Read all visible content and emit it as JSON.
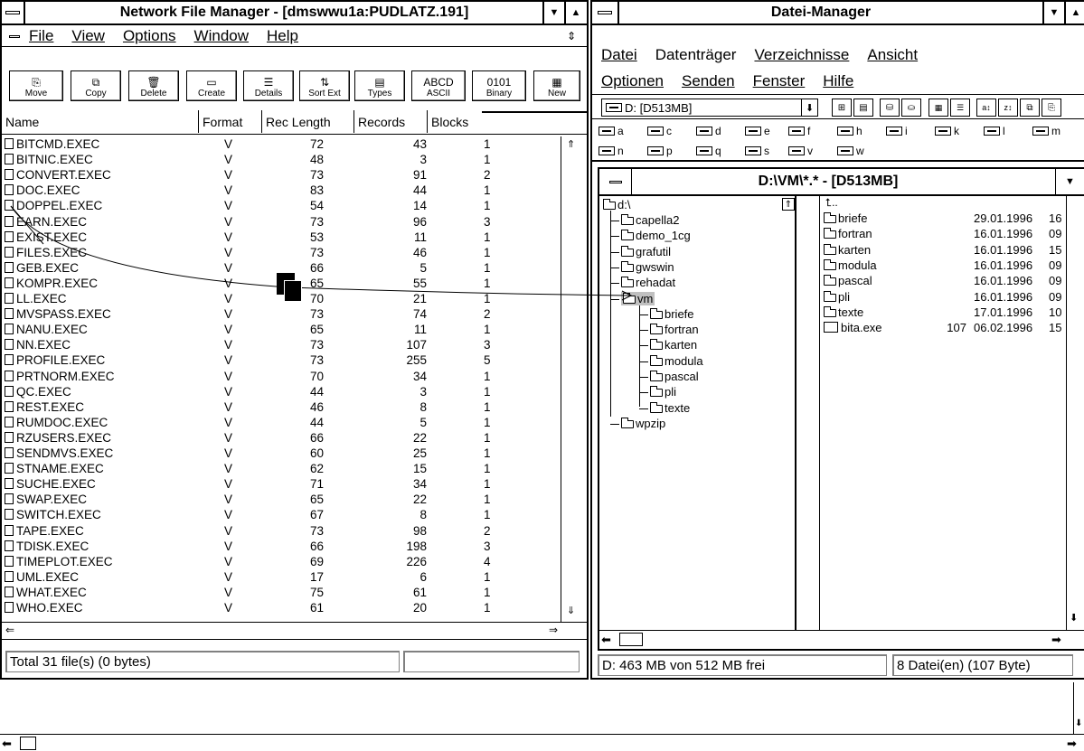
{
  "left": {
    "title": "Network File Manager - [dmswwu1a:PUDLATZ.191]",
    "menu": [
      "File",
      "View",
      "Options",
      "Window",
      "Help"
    ],
    "toolbar": [
      {
        "label": "Move",
        "icon": "move-icon",
        "glyph": "⎘"
      },
      {
        "label": "Copy",
        "icon": "copy-icon",
        "glyph": "⧉"
      },
      {
        "label": "Delete",
        "icon": "delete-icon",
        "glyph": "🗑"
      },
      {
        "label": "Create",
        "icon": "create-icon",
        "glyph": "▭"
      },
      {
        "label": "Details",
        "icon": "details-icon",
        "glyph": "☰"
      },
      {
        "label": "Sort Ext",
        "icon": "sort-ext-icon",
        "glyph": "⇅"
      },
      {
        "label": "Types",
        "icon": "types-icon",
        "glyph": "▤"
      },
      {
        "label": "ASCII",
        "icon": "ascii-icon",
        "glyph": "ABCD"
      },
      {
        "label": "Binary",
        "icon": "binary-icon",
        "glyph": "0101"
      },
      {
        "label": "New",
        "icon": "new-window-icon",
        "glyph": "▦"
      }
    ],
    "columns": [
      "Name",
      "Format",
      "Rec Length",
      "Records",
      "Blocks"
    ],
    "files": [
      {
        "name": "BITCMD.EXEC",
        "format": "V",
        "reclen": "72",
        "records": "43",
        "blocks": "1"
      },
      {
        "name": "BITNIC.EXEC",
        "format": "V",
        "reclen": "48",
        "records": "3",
        "blocks": "1"
      },
      {
        "name": "CONVERT.EXEC",
        "format": "V",
        "reclen": "73",
        "records": "91",
        "blocks": "2"
      },
      {
        "name": "DOC.EXEC",
        "format": "V",
        "reclen": "83",
        "records": "44",
        "blocks": "1"
      },
      {
        "name": "DOPPEL.EXEC",
        "format": "V",
        "reclen": "54",
        "records": "14",
        "blocks": "1"
      },
      {
        "name": "EARN.EXEC",
        "format": "V",
        "reclen": "73",
        "records": "96",
        "blocks": "3"
      },
      {
        "name": "EXIST.EXEC",
        "format": "V",
        "reclen": "53",
        "records": "11",
        "blocks": "1"
      },
      {
        "name": "FILES.EXEC",
        "format": "V",
        "reclen": "73",
        "records": "46",
        "blocks": "1"
      },
      {
        "name": "GEB.EXEC",
        "format": "V",
        "reclen": "66",
        "records": "5",
        "blocks": "1"
      },
      {
        "name": "KOMPR.EXEC",
        "format": "V",
        "reclen": "65",
        "records": "55",
        "blocks": "1"
      },
      {
        "name": "LL.EXEC",
        "format": "V",
        "reclen": "70",
        "records": "21",
        "blocks": "1"
      },
      {
        "name": "MVSPASS.EXEC",
        "format": "V",
        "reclen": "73",
        "records": "74",
        "blocks": "2"
      },
      {
        "name": "NANU.EXEC",
        "format": "V",
        "reclen": "65",
        "records": "11",
        "blocks": "1"
      },
      {
        "name": "NN.EXEC",
        "format": "V",
        "reclen": "73",
        "records": "107",
        "blocks": "3"
      },
      {
        "name": "PROFILE.EXEC",
        "format": "V",
        "reclen": "73",
        "records": "255",
        "blocks": "5"
      },
      {
        "name": "PRTNORM.EXEC",
        "format": "V",
        "reclen": "70",
        "records": "34",
        "blocks": "1"
      },
      {
        "name": "QC.EXEC",
        "format": "V",
        "reclen": "44",
        "records": "3",
        "blocks": "1"
      },
      {
        "name": "REST.EXEC",
        "format": "V",
        "reclen": "46",
        "records": "8",
        "blocks": "1"
      },
      {
        "name": "RUMDOC.EXEC",
        "format": "V",
        "reclen": "44",
        "records": "5",
        "blocks": "1"
      },
      {
        "name": "RZUSERS.EXEC",
        "format": "V",
        "reclen": "66",
        "records": "22",
        "blocks": "1"
      },
      {
        "name": "SENDMVS.EXEC",
        "format": "V",
        "reclen": "60",
        "records": "25",
        "blocks": "1"
      },
      {
        "name": "STNAME.EXEC",
        "format": "V",
        "reclen": "62",
        "records": "15",
        "blocks": "1"
      },
      {
        "name": "SUCHE.EXEC",
        "format": "V",
        "reclen": "71",
        "records": "34",
        "blocks": "1"
      },
      {
        "name": "SWAP.EXEC",
        "format": "V",
        "reclen": "65",
        "records": "22",
        "blocks": "1"
      },
      {
        "name": "SWITCH.EXEC",
        "format": "V",
        "reclen": "67",
        "records": "8",
        "blocks": "1"
      },
      {
        "name": "TAPE.EXEC",
        "format": "V",
        "reclen": "73",
        "records": "98",
        "blocks": "2"
      },
      {
        "name": "TDISK.EXEC",
        "format": "V",
        "reclen": "66",
        "records": "198",
        "blocks": "3"
      },
      {
        "name": "TIMEPLOT.EXEC",
        "format": "V",
        "reclen": "69",
        "records": "226",
        "blocks": "4"
      },
      {
        "name": "UML.EXEC",
        "format": "V",
        "reclen": "17",
        "records": "6",
        "blocks": "1"
      },
      {
        "name": "WHAT.EXEC",
        "format": "V",
        "reclen": "75",
        "records": "61",
        "blocks": "1"
      },
      {
        "name": "WHO.EXEC",
        "format": "V",
        "reclen": "61",
        "records": "20",
        "blocks": "1"
      }
    ],
    "status": "Total 31 file(s) (0 bytes)"
  },
  "right": {
    "title": "Datei-Manager",
    "menu1": [
      "Datei",
      "Datenträger",
      "Verzeichnisse",
      "Ansicht"
    ],
    "menu2": [
      "Optionen",
      "Senden",
      "Fenster",
      "Hilfe"
    ],
    "drive_select": "D: [D513MB]",
    "drives": [
      "a",
      "c",
      "d",
      "e",
      "f",
      "h",
      "i",
      "k",
      "l",
      "m",
      "n",
      "p",
      "q",
      "s",
      "v",
      "w"
    ],
    "child_title": "D:\\VM\\*.* - [D513MB]",
    "tree_root": "d:\\",
    "tree": [
      "capella2",
      "demo_1cg",
      "grafutil",
      "gwswin",
      "rehadat",
      "vm"
    ],
    "tree_vm_children": [
      "briefe",
      "fortran",
      "karten",
      "modula",
      "pascal",
      "pli",
      "texte"
    ],
    "tree_last": "wpzip",
    "up_entry": "..",
    "entries": [
      {
        "name": "briefe",
        "size": "",
        "date": "29.01.1996",
        "time": "16"
      },
      {
        "name": "fortran",
        "size": "",
        "date": "16.01.1996",
        "time": "09"
      },
      {
        "name": "karten",
        "size": "",
        "date": "16.01.1996",
        "time": "15"
      },
      {
        "name": "modula",
        "size": "",
        "date": "16.01.1996",
        "time": "09"
      },
      {
        "name": "pascal",
        "size": "",
        "date": "16.01.1996",
        "time": "09"
      },
      {
        "name": "pli",
        "size": "",
        "date": "16.01.1996",
        "time": "09"
      },
      {
        "name": "texte",
        "size": "",
        "date": "17.01.1996",
        "time": "10"
      },
      {
        "name": "bita.exe",
        "size": "107",
        "date": "06.02.1996",
        "time": "15"
      }
    ],
    "status_left": "D: 463 MB von 512 MB frei",
    "status_right": "8 Datei(en) (107 Byte)"
  }
}
